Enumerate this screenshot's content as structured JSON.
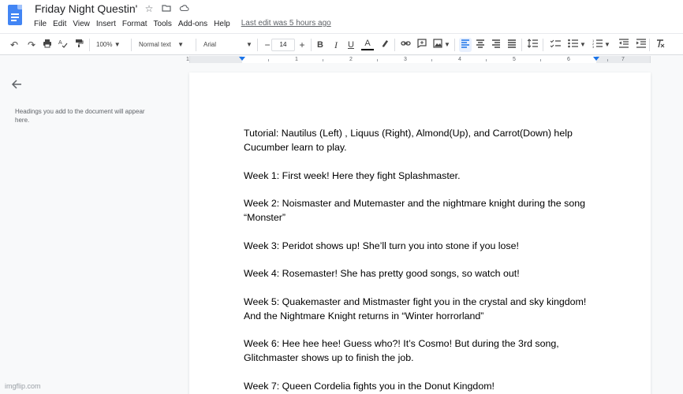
{
  "header": {
    "doc_title": "Friday Night Questin'",
    "last_edit": "Last edit was 5 hours ago",
    "menu": [
      "File",
      "Edit",
      "View",
      "Insert",
      "Format",
      "Tools",
      "Add-ons",
      "Help"
    ]
  },
  "toolbar": {
    "zoom": "100%",
    "style": "Normal text",
    "font": "Arial",
    "font_size": "14",
    "minus": "−",
    "plus": "+",
    "bold": "B",
    "italic": "I",
    "underline": "U",
    "text_color": "A"
  },
  "ruler": {
    "numbers": [
      "1",
      "1",
      "2",
      "3",
      "4",
      "5",
      "6",
      "7"
    ]
  },
  "outline": {
    "hint": "Headings you add to the document will appear here."
  },
  "document": {
    "paragraphs": [
      "Tutorial: Nautilus (Left) , Liquus (Right), Almond(Up), and Carrot(Down) help Cucumber learn to play.",
      "Week 1: First week! Here they fight Splashmaster.",
      "Week 2: Noismaster and Mutemaster and the nightmare knight during the song “Monster”",
      "Week 3: Peridot shows up! She’ll turn you into stone if you lose!",
      "Week 4: Rosemaster! She has pretty good songs, so watch out!",
      "Week 5: Quakemaster and Mistmaster fight you in the crystal and sky kingdom! And the Nightmare Knight returns in “Winter horrorland”",
      "Week 6: Hee hee hee! Guess who?! It’s Cosmo! But during the 3rd song, Glitchmaster shows up to finish the job.",
      "Week 7: Queen Cordelia fights you in the Donut Kingdom!"
    ]
  },
  "watermark": "imgflip.com",
  "colors": {
    "accent": "#1a73e8",
    "doc_icon": "#4285f4"
  }
}
